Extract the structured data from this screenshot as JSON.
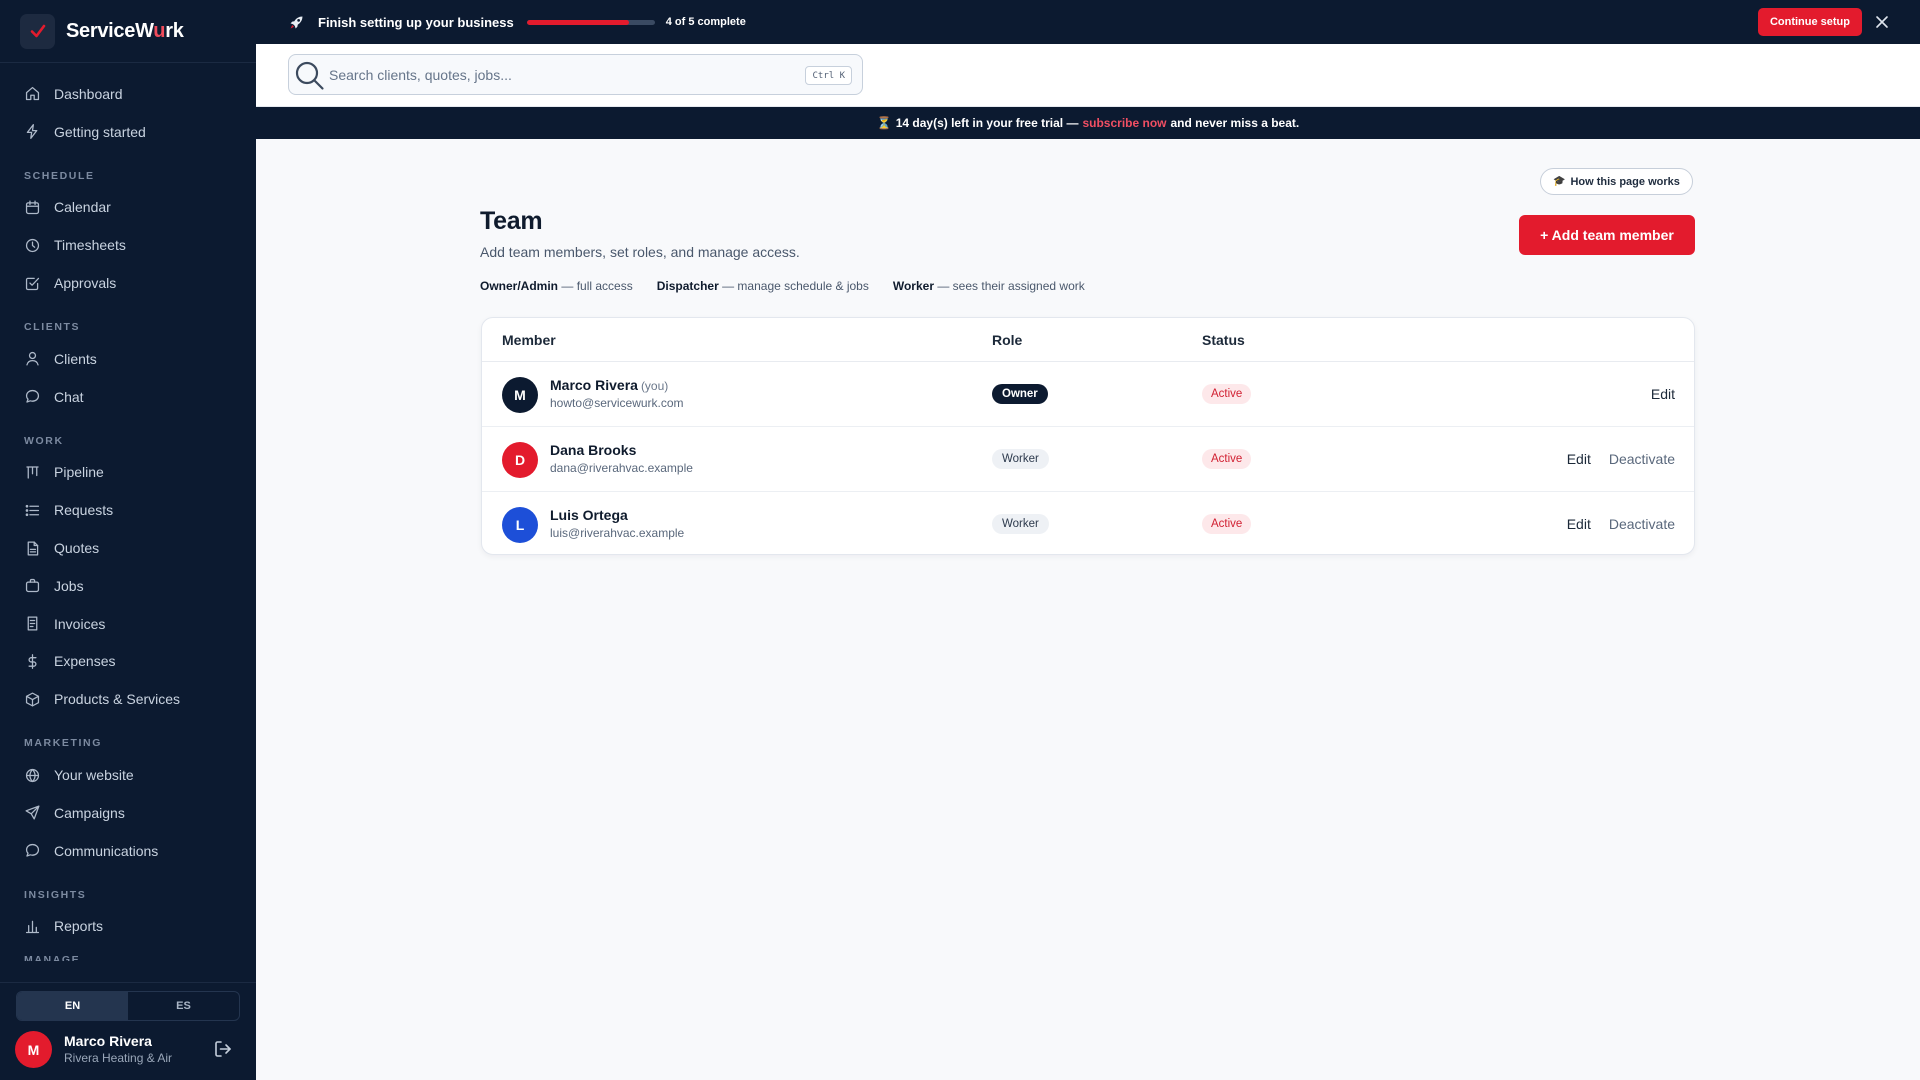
{
  "brand": {
    "name_main": "ServiceW",
    "name_accent": "u",
    "name_end": "rk"
  },
  "sidebar": {
    "top_items": [
      {
        "label": "Dashboard",
        "icon": "home-icon"
      },
      {
        "label": "Getting started",
        "icon": "bolt-icon"
      }
    ],
    "sections": [
      {
        "title": "SCHEDULE",
        "items": [
          {
            "label": "Calendar",
            "icon": "calendar-icon"
          },
          {
            "label": "Timesheets",
            "icon": "clock-icon"
          },
          {
            "label": "Approvals",
            "icon": "check-square-icon"
          }
        ]
      },
      {
        "title": "CLIENTS",
        "items": [
          {
            "label": "Clients",
            "icon": "user-icon"
          },
          {
            "label": "Chat",
            "icon": "chat-bubble-icon"
          }
        ]
      },
      {
        "title": "WORK",
        "items": [
          {
            "label": "Pipeline",
            "icon": "kanban-icon"
          },
          {
            "label": "Requests",
            "icon": "list-icon"
          },
          {
            "label": "Quotes",
            "icon": "document-icon"
          },
          {
            "label": "Jobs",
            "icon": "briefcase-icon"
          },
          {
            "label": "Invoices",
            "icon": "invoice-icon"
          },
          {
            "label": "Expenses",
            "icon": "dollar-icon"
          },
          {
            "label": "Products & Services",
            "icon": "box-icon"
          }
        ]
      },
      {
        "title": "MARKETING",
        "items": [
          {
            "label": "Your website",
            "icon": "globe-icon"
          },
          {
            "label": "Campaigns",
            "icon": "send-icon"
          },
          {
            "label": "Communications",
            "icon": "message-icon"
          }
        ]
      },
      {
        "title": "INSIGHTS",
        "items": [
          {
            "label": "Reports",
            "icon": "bar-chart-icon"
          }
        ]
      }
    ],
    "cut_section": "MANAGE",
    "languages": [
      "EN",
      "ES"
    ],
    "active_language": "EN",
    "user": {
      "initial": "M",
      "name": "Marco Rivera",
      "company": "Rivera Heating & Air"
    }
  },
  "setup": {
    "title": "Finish setting up your business",
    "progress_fraction": 0.8,
    "count_text": "4 of 5 complete",
    "continue_label": "Continue setup"
  },
  "search": {
    "placeholder": "Search clients, quotes, jobs...",
    "shortcut": "Ctrl K"
  },
  "trial": {
    "icon": "⏳",
    "days": "14",
    "text_a": "day(s) left in your free trial —",
    "link": "subscribe now",
    "text_b": "and never miss a beat."
  },
  "page": {
    "how_label": "How this page works",
    "title": "Team",
    "subtitle": "Add team members, set roles, and manage access.",
    "add_label": "+ Add team member",
    "roles": [
      {
        "name": "Owner/Admin",
        "desc": "— full access"
      },
      {
        "name": "Dispatcher",
        "desc": "— manage schedule & jobs"
      },
      {
        "name": "Worker",
        "desc": "— sees their assigned work"
      }
    ]
  },
  "table": {
    "headers": [
      "Member",
      "Role",
      "Status"
    ],
    "rows": [
      {
        "initial": "M",
        "avatar_color": "#0c1a30",
        "name": "Marco Rivera",
        "you": "(you)",
        "email": "howto@servicewurk.com",
        "role": "Owner",
        "role_type": "owner",
        "status": "Active",
        "actions": [
          "Edit"
        ]
      },
      {
        "initial": "D",
        "avatar_color": "#e31b2d",
        "name": "Dana Brooks",
        "you": "",
        "email": "dana@riverahvac.example",
        "role": "Worker",
        "role_type": "worker",
        "status": "Active",
        "actions": [
          "Edit",
          "Deactivate"
        ]
      },
      {
        "initial": "L",
        "avatar_color": "#1d4fd8",
        "name": "Luis Ortega",
        "you": "",
        "email": "luis@riverahvac.example",
        "role": "Worker",
        "role_type": "worker",
        "status": "Active",
        "actions": [
          "Edit",
          "Deactivate"
        ]
      }
    ]
  },
  "colors": {
    "accent": "#e31b2d",
    "navy": "#0c1a30",
    "link": "#f04f63"
  }
}
